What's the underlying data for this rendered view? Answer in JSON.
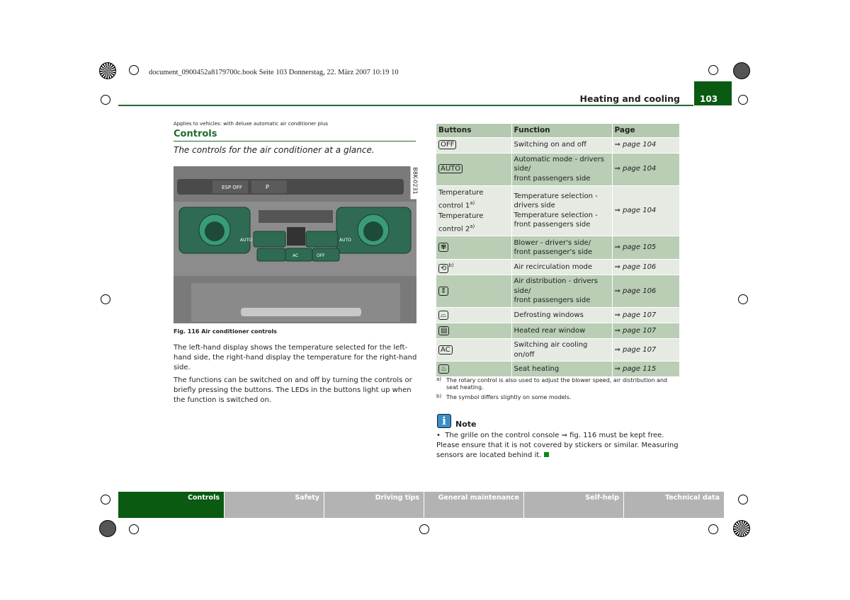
{
  "print_header": "document_0900452a8179700c.book  Seite 103  Donnerstag, 22. März 2007  10:19 10",
  "section_title": "Heating and cooling",
  "page_number": "103",
  "applies_to": "Applies to vehicles: with deluxe automatic air conditioner plus",
  "heading": "Controls",
  "subheading": "The controls for the air conditioner at a glance.",
  "figure": {
    "code": "B8K-0231",
    "caption": "Fig. 116  Air conditioner controls",
    "labels": {
      "esp": "ESP OFF",
      "park": "P",
      "auto": "AUTO",
      "ac": "AC",
      "off": "OFF"
    }
  },
  "body": [
    "The left-hand display shows the temperature selected for the left-hand side, the right-hand display the temperature for the right-hand side.",
    "The functions can be switched on and off by turning the controls or briefly pressing the buttons. The LEDs in the buttons light up when the function is switched on."
  ],
  "table": {
    "headers": [
      "Buttons",
      "Function",
      "Page"
    ],
    "rows": [
      {
        "button": "OFF",
        "function": "Switching on and off",
        "page": "⇒ page 104"
      },
      {
        "button": "AUTO",
        "function": "Automatic mode - drivers side/\nfront passengers side",
        "page": "⇒ page 104"
      },
      {
        "button": "Temperature control 1",
        "function": "Temperature selection - drivers side\nTemperature selection - front passengers side",
        "page": "⇒ page 104",
        "button2": "Temperature control 2",
        "sup": "a)"
      },
      {
        "button_icon": "fan-icon",
        "function": "Blower - driver's side/\nfront passenger's side",
        "page": "⇒ page 105"
      },
      {
        "button_icon": "recirculation-icon",
        "sup": "b)",
        "function": "Air recirculation mode",
        "page": "⇒ page 106"
      },
      {
        "button_icon": "air-distribution-icon",
        "function": "Air distribution - drivers side/\nfront passengers side",
        "page": "⇒ page 106"
      },
      {
        "button_icon": "defrost-icon",
        "function": "Defrosting windows",
        "page": "⇒ page 107"
      },
      {
        "button_icon": "rear-window-heat-icon",
        "function": "Heated rear window",
        "page": "⇒ page 107"
      },
      {
        "button": "AC",
        "function": "Switching air cooling on/off",
        "page": "⇒ page 107"
      },
      {
        "button_icon": "seat-heating-icon",
        "function": "Seat heating",
        "page": "⇒ page 115"
      }
    ]
  },
  "footnotes": [
    {
      "mark": "a)",
      "text": "The rotary control is also used to adjust the blower speed, air distribution and seat heating."
    },
    {
      "mark": "b)",
      "text": "The symbol differs slightly on some models."
    }
  ],
  "note": {
    "title": "Note",
    "text": "The grille on the control console ⇒ fig. 116 must be kept free. Please ensure that it is not covered by stickers or similar. Measuring sensors are located behind it."
  },
  "tabs": [
    "Controls",
    "Safety",
    "Driving tips",
    "General maintenance",
    "Self-help",
    "Technical data"
  ],
  "colors": {
    "accent": "#0a5a12",
    "table_light": "#e5ebe3",
    "table_dark": "#b9ceb5",
    "tab_inactive": "#b3b3b3"
  }
}
